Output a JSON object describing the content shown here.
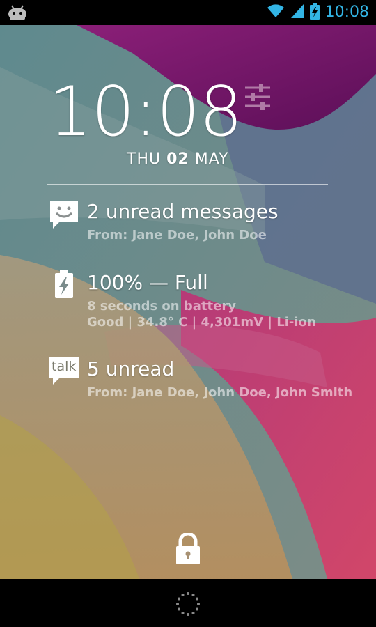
{
  "status_bar": {
    "time": "10:08",
    "left_icon": "android-debug-icon",
    "right_icons": [
      "wifi-icon",
      "cell-signal-icon",
      "battery-charging-icon"
    ],
    "accent_color": "#33b5e5"
  },
  "clock": {
    "time": "10:08",
    "date_day": "THU",
    "date_num": "02",
    "date_month": "MAY"
  },
  "notifications": [
    {
      "icon": "message-smiley-icon",
      "title": "2 unread messages",
      "lines": [
        "From: Jane Doe, John Doe"
      ]
    },
    {
      "icon": "battery-charging-icon",
      "title": "100% — Full",
      "lines": [
        "8 seconds on battery",
        "Good | 34.8° C | 4,301mV | Li-ion"
      ]
    },
    {
      "icon": "talk-icon",
      "icon_text": "talk",
      "title": "5 unread",
      "lines": [
        "From: Jane Doe, John Doe, John Smith"
      ]
    }
  ],
  "lock": {
    "icon": "lock-icon"
  },
  "navigation": {
    "icon": "loading-spinner-icon"
  }
}
